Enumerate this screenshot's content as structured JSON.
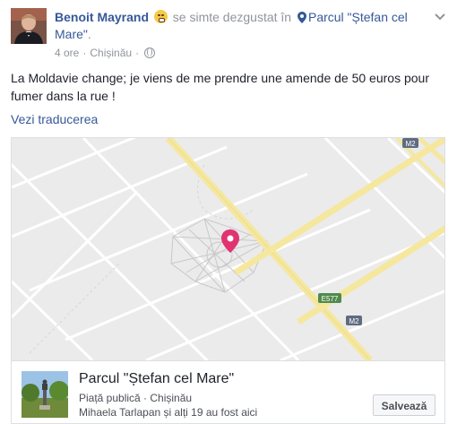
{
  "post": {
    "author": "Benoit Mayrand",
    "feeling_text": "se simte dezgustat în",
    "location": "Parcul \"Ștefan cel Mare\"",
    "location_suffix": ".",
    "time": "4 ore",
    "separator": "·",
    "city": "Chișinău",
    "body": "La Moldavie change; je viens de me prendre une amende de 50 euros pour fumer dans la rue !",
    "translate_label": "Vezi traducerea"
  },
  "map": {
    "road_labels": [
      "M2",
      "E577",
      "M2"
    ],
    "road_color": "#f5e79e",
    "marker_color": "#e0336f"
  },
  "place": {
    "name": "Parcul \"Ștefan cel Mare\"",
    "category": "Piață publică · Chișinău",
    "visitors": "Mihaela Tarlapan și alți 19 au fost aici",
    "save_label": "Salvează"
  },
  "colors": {
    "link": "#365899",
    "secondary": "#90949c",
    "text": "#1d2129"
  }
}
